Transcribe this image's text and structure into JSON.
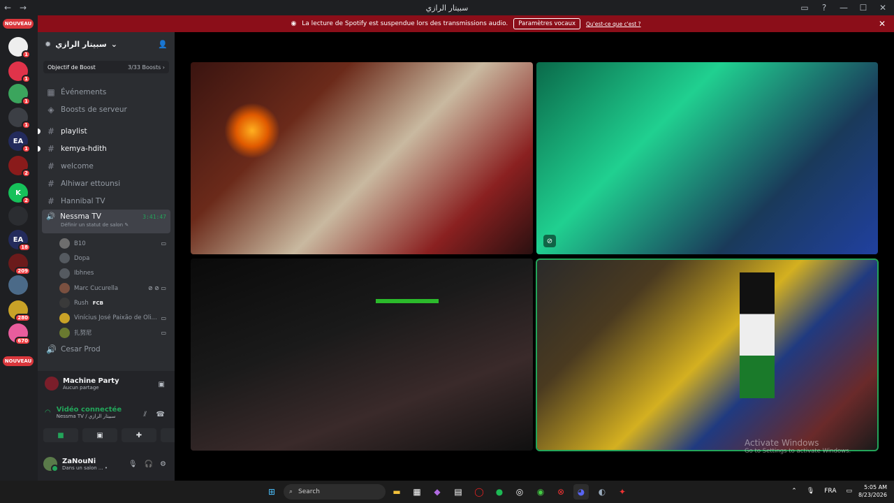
{
  "window": {
    "title": "سبيتار الرازي"
  },
  "banner": {
    "text": "La lecture de Spotify est suspendue lors des transmissions audio.",
    "button": "Paramètres vocaux",
    "link": "Qu'est-ce que c'est ?"
  },
  "servers": {
    "nouveau_top": "NOUVEAU",
    "nouveau_bottom": "NOUVEAU",
    "items": [
      {
        "badge": "1",
        "color": "#eeeeee",
        "label": ""
      },
      {
        "badge": "1",
        "color": "#e0334a",
        "label": ""
      },
      {
        "badge": "1",
        "color": "#3ba55d",
        "label": ""
      },
      {
        "badge": "1",
        "color": "#3c3f45",
        "label": ""
      },
      {
        "badge": "1",
        "color": "#232b5c",
        "label": "EA"
      },
      {
        "badge": "2",
        "color": "#8a1b1b",
        "label": ""
      },
      {
        "badge": "2",
        "color": "#16c15a",
        "label": "K"
      },
      {
        "badge": "",
        "color": "#2b2d31",
        "label": ""
      },
      {
        "badge": "18",
        "color": "#232b5c",
        "label": "EA"
      },
      {
        "badge": "209",
        "color": "#6b1b1b",
        "label": ""
      },
      {
        "badge": "",
        "color": "#4b6a88",
        "label": ""
      },
      {
        "badge": "280",
        "color": "#c9a227",
        "label": ""
      },
      {
        "badge": "670",
        "color": "#e85d9d",
        "label": ""
      }
    ]
  },
  "guild": {
    "name": "سبيتار الرازي",
    "boost_label": "Objectif de Boost",
    "boost_count": "3/33 Boosts"
  },
  "channels": {
    "events": "Événements",
    "boosts": "Boosts de serveur",
    "list": [
      {
        "name": "playlist",
        "bold": true
      },
      {
        "name": "kemya-hdith",
        "bold": true
      },
      {
        "name": "welcome",
        "bold": false
      },
      {
        "name": "Alhiwar ettounsi",
        "bold": false
      },
      {
        "name": "Hannibal TV",
        "bold": false
      }
    ],
    "active_voice": {
      "name": "Nessma TV",
      "timer": "3:41:47",
      "status": "Définir un statut de salon"
    },
    "members": [
      {
        "name": "B10",
        "color": "#6e6e6e",
        "icons": "▭"
      },
      {
        "name": "Dopa",
        "color": "#555a60",
        "icons": ""
      },
      {
        "name": "Ibhnes",
        "color": "#555a60",
        "icons": ""
      },
      {
        "name": "Marc Cucurella",
        "color": "#7a5040",
        "icons": "⊘ ⊘ ▭"
      },
      {
        "name": "Rush",
        "color": "#3a3a3a",
        "icons": "",
        "tag": "FCB"
      },
      {
        "name": "Vinícius José Paixão de Oli...",
        "color": "#c9a227",
        "icons": "▭"
      },
      {
        "name": "扎努尼",
        "color": "#6a7a30",
        "icons": "▭"
      }
    ],
    "next": "Cesar Prod"
  },
  "panel": {
    "activity_title": "Machine Party",
    "activity_sub": "Aucun partage",
    "rtc_title": "Vidéo connectée",
    "rtc_sub": "Nessma TV / سبيتار الرازي",
    "user_name": "ZaNouNi",
    "user_status": "Dans un salon ... •"
  },
  "watermark": {
    "line1": "Activate Windows",
    "line2": "Go to Settings to activate Windows."
  },
  "taskbar": {
    "search": "Search",
    "lang": "FRA",
    "time": "5:05 AM",
    "date": "8/23/2026"
  }
}
